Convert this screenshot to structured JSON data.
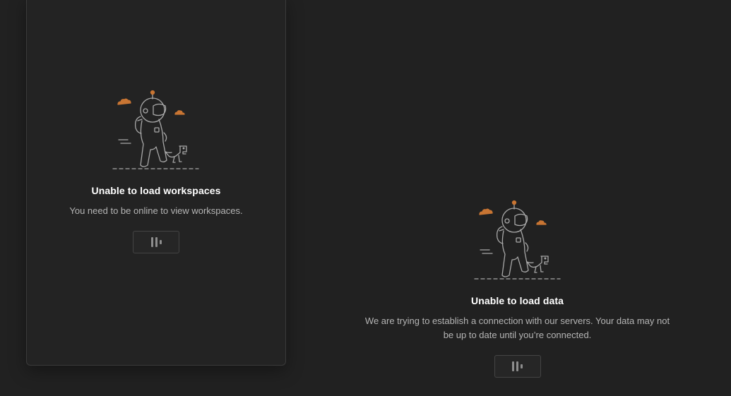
{
  "workspaces_error": {
    "title": "Unable to load workspaces",
    "description": "You need to be online to view workspaces.",
    "illustration": "astronaut-with-dinosaur"
  },
  "data_error": {
    "title": "Unable to load data",
    "description": "We are trying to establish a connection with our servers. Your data may not be up to date until you’re connected.",
    "illustration": "astronaut-with-dinosaur"
  },
  "loader": {
    "icon": "loading-bars-icon"
  },
  "colors": {
    "background": "#212121",
    "panel_border": "#3a3a3a",
    "accent_orange": "#c87533",
    "line_art": "#a8a8a8",
    "title_text": "#ffffff",
    "body_text": "#b5b5b5"
  }
}
